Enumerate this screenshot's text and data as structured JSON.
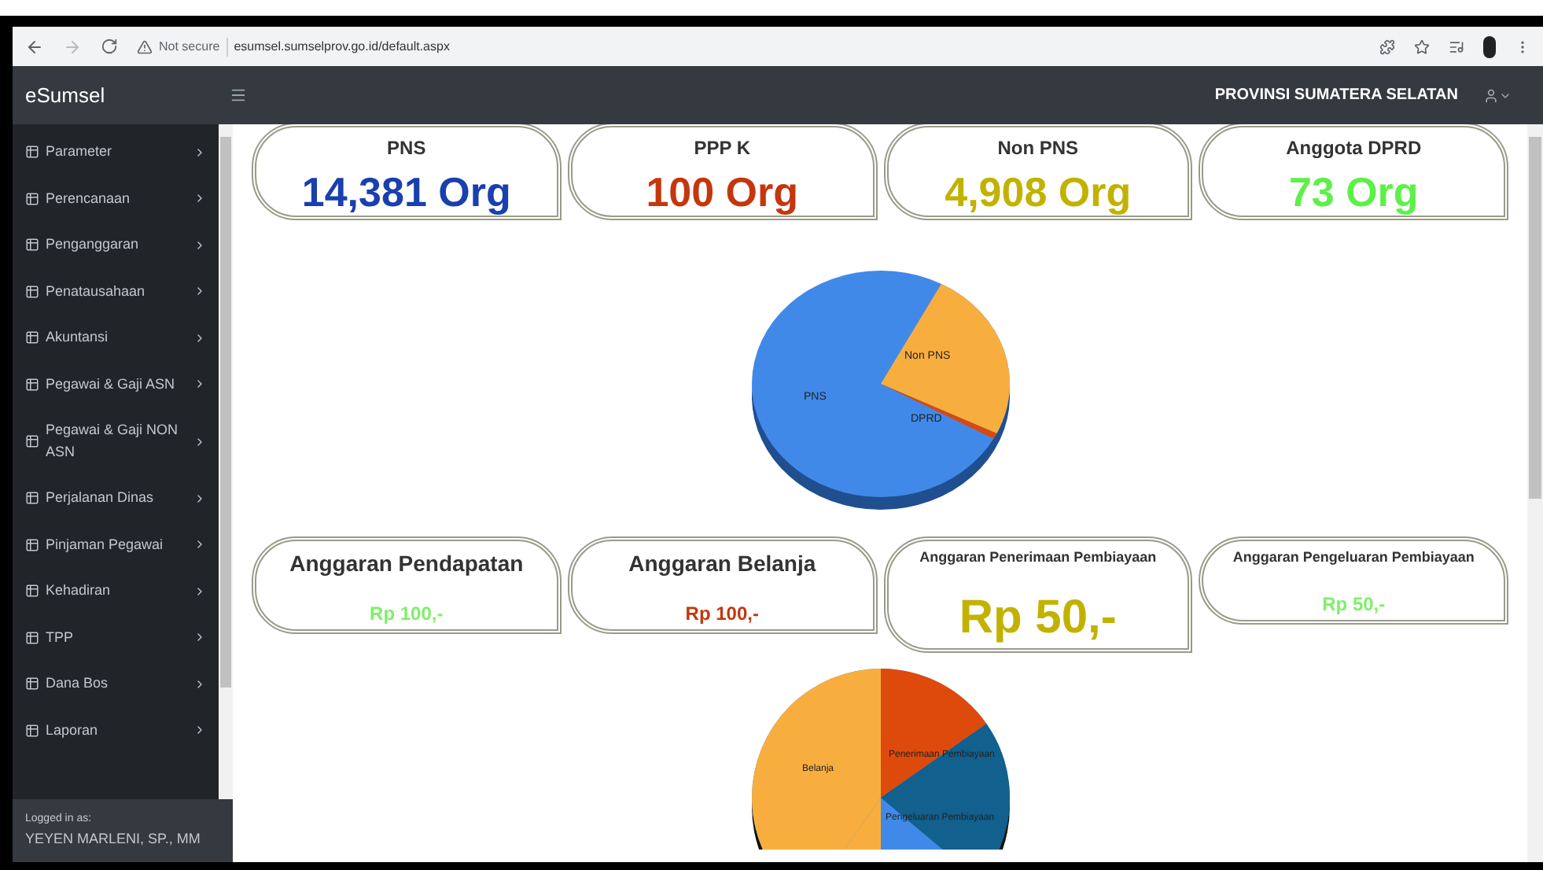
{
  "browser": {
    "security": "Not secure",
    "url": "esumsel.sumselprov.go.id/default.aspx"
  },
  "header": {
    "brand": "eSumsel",
    "region": "PROVINSI SUMATERA SELATAN"
  },
  "sidebar": {
    "items": [
      {
        "label": "Parameter"
      },
      {
        "label": "Perencanaan"
      },
      {
        "label": "Penganggaran"
      },
      {
        "label": "Penatausahaan"
      },
      {
        "label": "Akuntansi"
      },
      {
        "label": "Pegawai & Gaji ASN"
      },
      {
        "label": "Pegawai & Gaji NON ASN"
      },
      {
        "label": "Perjalanan Dinas"
      },
      {
        "label": "Pinjaman Pegawai"
      },
      {
        "label": "Kehadiran"
      },
      {
        "label": "TPP"
      },
      {
        "label": "Dana Bos"
      },
      {
        "label": "Laporan"
      }
    ],
    "footer_label": "Logged in as:",
    "user": "YEYEN MARLENI, SP., MM"
  },
  "employee_cards": [
    {
      "title": "PNS",
      "value": "14,381 Org",
      "color": "#1a3fae"
    },
    {
      "title": "PPP K",
      "value": "100 Org",
      "color": "#c4370e"
    },
    {
      "title": "Non PNS",
      "value": "4,908 Org",
      "color": "#c2b200"
    },
    {
      "title": "Anggota DPRD",
      "value": "73 Org",
      "color": "#5ef04a"
    }
  ],
  "employee_pie_labels": [
    "Non PNS",
    "PNS",
    "DPRD"
  ],
  "budget_cards": [
    {
      "title": "Anggaran Pendapatan",
      "value": "Rp 100,-",
      "color": "#7ef06a",
      "kind": "large"
    },
    {
      "title": "Anggaran Belanja",
      "value": "Rp 100,-",
      "color": "#c4370e",
      "kind": "large"
    },
    {
      "title": "Anggaran Penerimaan Pembiayaan",
      "value": "Rp 50,-",
      "color": "#c2b200",
      "kind": "highlight"
    },
    {
      "title": "Anggaran Pengeluaran Pembiayaan",
      "value": "Rp 50,-",
      "color": "#7ef06a",
      "kind": "small"
    }
  ],
  "budget_pie_labels": [
    "Penerimaan Pembiayaan",
    "Belanja",
    "Pengeluaran Pembiayaan"
  ]
}
